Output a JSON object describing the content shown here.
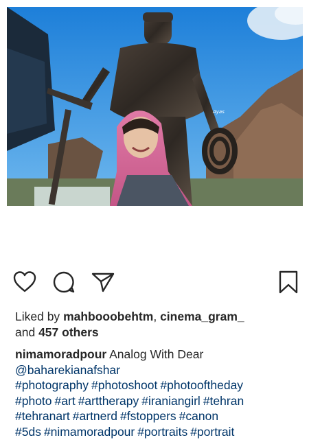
{
  "post": {
    "image_alt": "Woman in pink headscarf taking a selfie in front of a bronze mountaineer statue",
    "likes": {
      "prefix": "Liked by",
      "user1": "mahbooobehtm",
      "separator": ",",
      "user2": "cinema_gram_",
      "and": "and",
      "count_text": "457 others"
    },
    "caption": {
      "username": "nimamoradpour",
      "text": "Analog With Dear",
      "mention": "@baharekianafshar",
      "hashtags": [
        "#photography",
        "#photoshoot",
        "#photooftheday",
        "#photo",
        "#art",
        "#arttherapy",
        "#iraniangirl",
        "#tehran",
        "#tehranart",
        "#artnerd",
        "#fstoppers",
        "#canon",
        "#5ds",
        "#nimamoradpour",
        "#portraits",
        "#portrait"
      ]
    }
  },
  "actions": {
    "like_icon": "heart-outline-icon",
    "comment_icon": "speech-bubble-icon",
    "share_icon": "paper-plane-icon",
    "save_icon": "bookmark-icon"
  },
  "colors": {
    "text": "#262626",
    "hashtag": "#003569",
    "sky": "#2a8fe0",
    "scarf": "#d66a9a"
  }
}
